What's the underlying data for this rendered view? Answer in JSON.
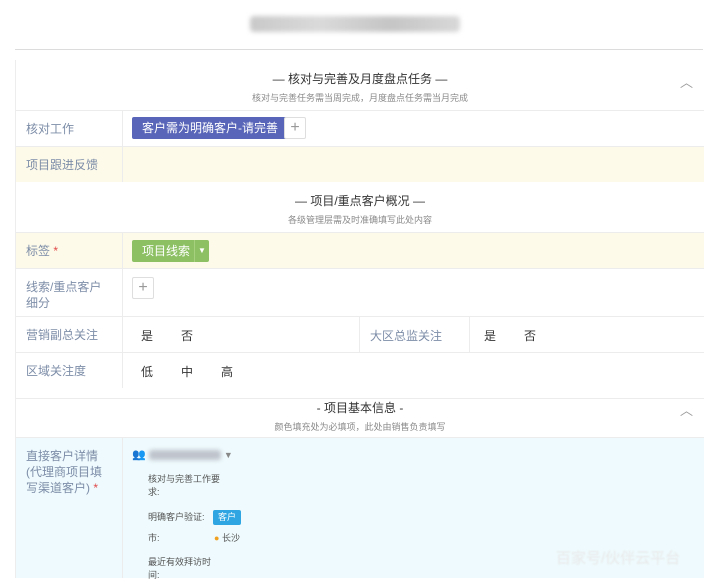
{
  "header": {
    "title_blurred": ""
  },
  "sections": {
    "verify": {
      "title": "— 核对与完善及月度盘点任务 —",
      "subtitle": "核对与完善任务需当周完成，月度盘点任务需当月完成"
    },
    "overview": {
      "title": "— 项目/重点客户概况 —",
      "subtitle": "各级管理层需及时准确填写此处内容"
    },
    "basic": {
      "title": "- 项目基本信息 -",
      "subtitle": "颜色填充处为必填项，此处由销售负责填写"
    }
  },
  "rows": {
    "verify_work": {
      "label": "核对工作",
      "button": "客户需为明确客户-请完善"
    },
    "followup": {
      "label": "项目跟进反馈"
    },
    "tags": {
      "label": "标签",
      "required": "*",
      "value": "项目线索"
    },
    "segment": {
      "label": "线索/重点客户细分"
    },
    "vp_focus": {
      "label": "营销副总关注",
      "yes": "是",
      "no": "否"
    },
    "region_director": {
      "label": "大区总监关注",
      "yes": "是",
      "no": "否"
    },
    "region_focus": {
      "label": "区域关注度",
      "low": "低",
      "mid": "中",
      "high": "高"
    },
    "direct_customer": {
      "label": "直接客户详情(代理商项目填写渠道客户)",
      "required": "*",
      "fields": {
        "verify_req_label": "核对与完善工作要求:",
        "confirm_label": "明确客户验证:",
        "confirm_tag": "客户",
        "city_label": "市:",
        "city_value": "长沙",
        "last_visit_label": "最近有效拜访时间:"
      }
    }
  },
  "watermark": "百家号/伙伴云平台",
  "colors": {
    "primary": "#5865b8",
    "green": "#8cc063",
    "yellow_bg": "#fdfae9",
    "blue_bg": "#eefafd",
    "label": "#7d8da8"
  }
}
